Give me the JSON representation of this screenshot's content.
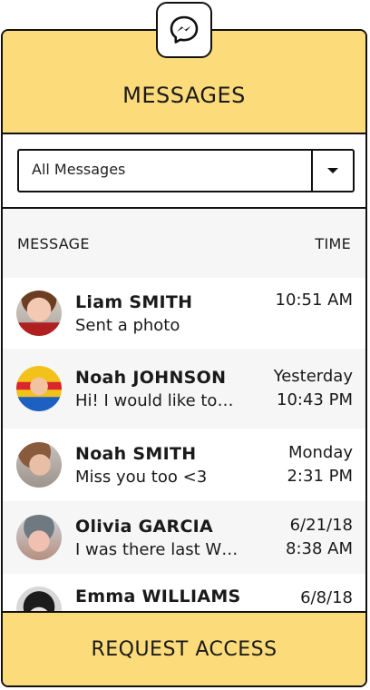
{
  "header": {
    "title": "MESSAGES",
    "logo_icon": "messenger-icon"
  },
  "filter": {
    "selected": "All Messages"
  },
  "columns": {
    "message": "MESSAGE",
    "time": "TIME"
  },
  "messages": [
    {
      "name": "Liam SMITH",
      "preview": "Sent a photo",
      "time_line1": "10:51 AM",
      "time_line2": ""
    },
    {
      "name": "Noah JOHNSON",
      "preview": "Hi! I would like to…",
      "time_line1": "Yesterday",
      "time_line2": "10:43 PM"
    },
    {
      "name": "Noah SMITH",
      "preview": "Miss you too <3",
      "time_line1": "Monday",
      "time_line2": "2:31 PM"
    },
    {
      "name": "Olivia GARCIA",
      "preview": "I was there last W…",
      "time_line1": "6/21/18",
      "time_line2": "8:38 AM"
    },
    {
      "name": "Emma WILLIAMS",
      "preview": "",
      "time_line1": "6/8/18",
      "time_line2": ""
    }
  ],
  "footer": {
    "button_label": "REQUEST ACCESS"
  },
  "colors": {
    "accent": "#fcdb7a",
    "border": "#111111",
    "alt_row": "#f6f6f6"
  }
}
